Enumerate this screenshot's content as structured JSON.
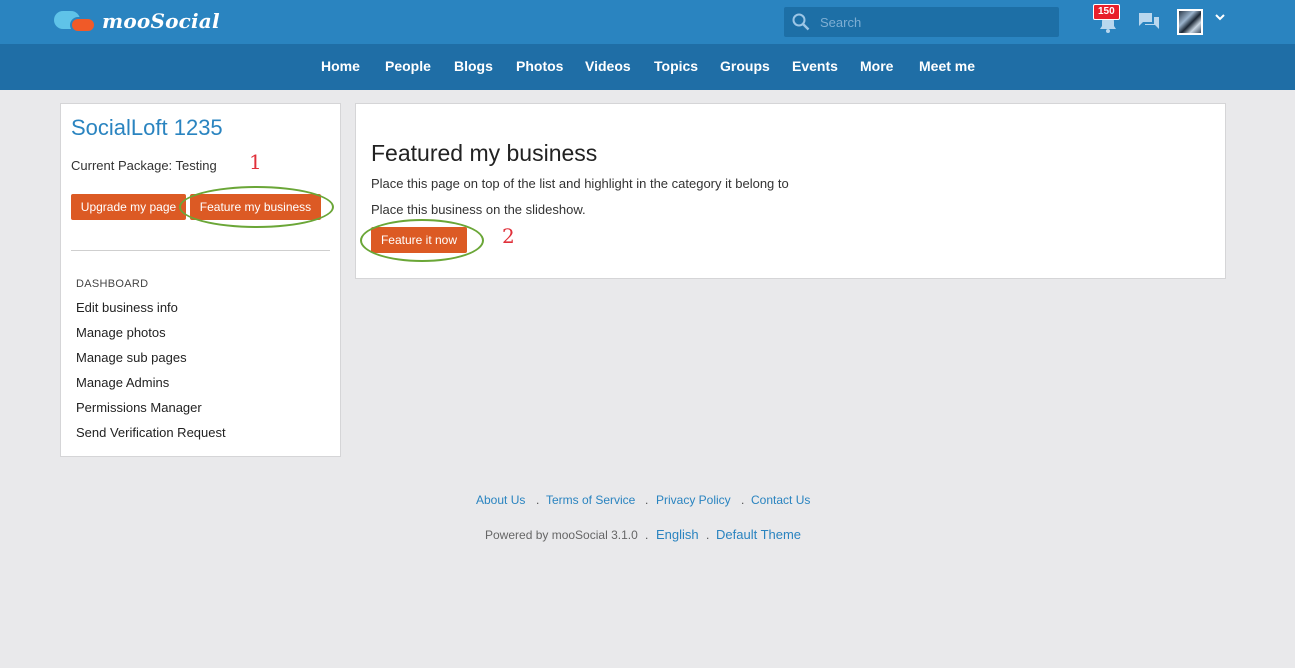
{
  "topbar": {
    "brand": "mooSocial",
    "search_placeholder": "Search",
    "notification_count": "150"
  },
  "nav": {
    "items": [
      "Home",
      "People",
      "Blogs",
      "Photos",
      "Videos",
      "Topics",
      "Groups",
      "Events",
      "More",
      "Meet me"
    ]
  },
  "sidebar": {
    "page_name": "SocialLoft 1235",
    "current_package": "Current Package: Testing",
    "upgrade_label": "Upgrade my page",
    "feature_label": "Feature my business",
    "dashboard_heading": "DASHBOARD",
    "menu": [
      "Edit business info",
      "Manage photos",
      "Manage sub pages",
      "Manage Admins",
      "Permissions Manager",
      "Send Verification Request"
    ]
  },
  "main": {
    "title": "Featured my business",
    "desc1": "Place this page on top of the list and highlight in the category it belong to",
    "desc2": "Place this business on the slideshow.",
    "feature_now_label": "Feature it now"
  },
  "annotations": {
    "num1": "1",
    "num2": "2",
    "color": "#6aa637",
    "num_color": "#e0303a"
  },
  "footer": {
    "links": [
      "About Us",
      "Terms of Service",
      "Privacy Policy",
      "Contact Us"
    ],
    "powered": "Powered by mooSocial 3.1.0",
    "language": "English",
    "theme": "Default Theme"
  },
  "colors": {
    "header": "#2a84c0",
    "nav": "#1f6ea6",
    "button": "#dc5a24",
    "link": "#2a84c0"
  }
}
